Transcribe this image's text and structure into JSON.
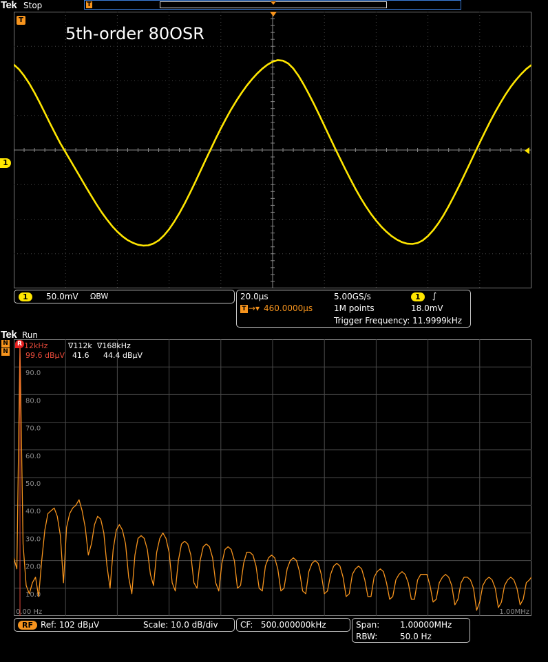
{
  "header": {
    "brand": "Tek",
    "status": "Stop",
    "trigger_marker": "T"
  },
  "scope": {
    "annotation": "5th-order 80OSR",
    "channel_marker": "1",
    "trigger_marker": "T",
    "trace_color": "#ffe600",
    "waveform": {
      "type": "line",
      "series": [
        {
          "x": [
            0.0,
            2.0,
            4.0,
            6.0,
            8.0,
            10.0,
            12.0,
            14.0,
            16.0,
            18.0,
            20.0,
            22.0,
            24.0,
            26.0,
            28.0,
            30.0,
            32.0,
            34.0,
            36.0,
            38.0,
            40.0,
            42.0,
            44.0,
            46.0,
            48.0,
            50.0,
            52.0,
            54.0,
            56.0,
            58.0,
            60.0,
            62.0,
            64.0,
            66.0,
            68.0,
            70.0,
            72.0,
            74.0,
            76.0,
            78.0,
            80.0,
            82.0,
            84.0,
            86.0,
            88.0,
            90.0,
            92.0,
            94.0,
            96.0,
            98.0,
            100.0,
            102.0,
            104.0,
            106.0,
            108.0,
            110.0,
            112.0,
            114.0,
            116.0,
            118.0,
            120.0,
            122.0,
            124.0,
            126.0,
            128.0,
            130.0,
            132.0,
            134.0,
            136.0,
            138.0,
            140.0,
            142.0,
            144.0,
            146.0,
            148.0,
            150.0,
            152.0,
            154.0,
            156.0,
            158.0,
            160.0,
            162.0,
            164.0,
            166.0,
            168.0,
            170.0,
            172.0,
            174.0,
            176.0,
            178.0,
            180.0,
            182.0,
            184.0,
            186.0,
            188.0,
            190.0,
            192.0,
            194.0,
            196.0,
            198.0,
            200.0
          ],
          "y": [
            61.8,
            58.4,
            53.7,
            48.0,
            41.5,
            34.4,
            26.9,
            19.3,
            11.9,
            4.8,
            -1.6,
            -7.9,
            -14.3,
            -20.7,
            -27.1,
            -33.3,
            -39.4,
            -45.1,
            -50.3,
            -55.0,
            -59.0,
            -62.4,
            -65.1,
            -67.1,
            -68.5,
            -69.1,
            -68.9,
            -67.6,
            -65.3,
            -61.8,
            -57.3,
            -51.8,
            -45.6,
            -38.7,
            -31.3,
            -23.6,
            -15.6,
            -7.6,
            0.3,
            8.1,
            15.6,
            22.7,
            29.4,
            35.6,
            41.3,
            46.5,
            51.1,
            55.2,
            58.8,
            61.7,
            63.9,
            65.0,
            64.6,
            62.6,
            58.9,
            53.7,
            47.4,
            40.5,
            33.1,
            25.4,
            17.5,
            9.6,
            1.8,
            -6.0,
            -13.6,
            -20.9,
            -28.0,
            -34.6,
            -40.7,
            -46.2,
            -51.1,
            -55.4,
            -59.1,
            -62.3,
            -64.8,
            -66.6,
            -67.7,
            -67.9,
            -67.2,
            -65.3,
            -62.2,
            -58.1,
            -53.1,
            -47.2,
            -40.6,
            -33.5,
            -26.1,
            -18.3,
            -10.4,
            -2.5,
            5.3,
            13.0,
            20.4,
            27.5,
            34.1,
            40.2,
            45.7,
            50.6,
            54.9,
            58.6,
            61.5
          ]
        }
      ],
      "xlim": [
        0,
        200
      ],
      "ylim": [
        -100,
        100
      ],
      "grid": true
    }
  },
  "scope_readout": {
    "channel": "1",
    "scale": "50.0mV",
    "bw_icon": "ΩBW",
    "timebase": "20.0µs",
    "sample_rate": "5.00GS/s",
    "trig_channel": "1",
    "trig_slope": "∫",
    "trig_label": "T",
    "delay": "460.0000µs",
    "record_length": "1M points",
    "trig_level": "18.0mV",
    "trig_freq": "Trigger Frequency: 11.9999kHz"
  },
  "spec_header": {
    "brand": "Tek",
    "status": "Run"
  },
  "spectrum": {
    "left_badges": [
      "N",
      "N"
    ],
    "ref_marker": "R",
    "cursors": [
      {
        "freq": "12kHz",
        "level": "99.6 dBµV",
        "color": "#f7941d"
      },
      {
        "freq": "∇112k",
        "level": "41.6",
        "color": "#ffffff"
      },
      {
        "freq": "∇168kHz",
        "level": "44.4 dBµV",
        "color": "#ffffff"
      }
    ],
    "trace_color": "#f7941d",
    "y_labels": [
      "90.0",
      "80.0",
      "70.0",
      "60.0",
      "50.0",
      "40.0",
      "30.0",
      "20.0",
      "10.0"
    ],
    "x_start_label": "0.00 Hz",
    "x_end_label": "1.00MHz",
    "chart_data": {
      "type": "line",
      "xlabel": "",
      "ylabel": "",
      "xlim": [
        0,
        1000
      ],
      "ylim": [
        2,
        102
      ],
      "grid": true,
      "series": [
        {
          "x": [
            0,
            6,
            12,
            18,
            24,
            30,
            36,
            42,
            48,
            54,
            60,
            66,
            72,
            78,
            84,
            90,
            96,
            102,
            108,
            114,
            120,
            126,
            132,
            138,
            144,
            150,
            156,
            162,
            168,
            174,
            180,
            186,
            192,
            198,
            204,
            210,
            216,
            222,
            228,
            234,
            240,
            246,
            252,
            258,
            264,
            270,
            276,
            282,
            288,
            294,
            300,
            306,
            312,
            318,
            324,
            330,
            336,
            342,
            348,
            354,
            360,
            366,
            372,
            378,
            384,
            390,
            396,
            402,
            408,
            414,
            420,
            426,
            432,
            438,
            444,
            450,
            456,
            462,
            468,
            474,
            480,
            486,
            492,
            498,
            504,
            510,
            516,
            522,
            528,
            534,
            540,
            546,
            552,
            558,
            564,
            570,
            576,
            582,
            588,
            594,
            600,
            606,
            612,
            618,
            624,
            630,
            636,
            642,
            648,
            654,
            660,
            666,
            672,
            678,
            684,
            690,
            696,
            702,
            708,
            714,
            720,
            726,
            732,
            738,
            744,
            750,
            756,
            762,
            768,
            774,
            780,
            786,
            792,
            798,
            804,
            810,
            816,
            822,
            828,
            834,
            840,
            846,
            852,
            858,
            864,
            870,
            876,
            882,
            888,
            894,
            900,
            906,
            912,
            918,
            924,
            930,
            936,
            942,
            948,
            954,
            960,
            966,
            972,
            978,
            984,
            990,
            996,
            1000
          ],
          "y": [
            23,
            19,
            99.6,
            28,
            13,
            10,
            14,
            16,
            9,
            22,
            33,
            39,
            40,
            41,
            38,
            31,
            14,
            34,
            39,
            41,
            42,
            44,
            40,
            34,
            24,
            28,
            35,
            38,
            37,
            32,
            20,
            12,
            26,
            33,
            35,
            33,
            28,
            16,
            10,
            24,
            30,
            31,
            30,
            26,
            17,
            13,
            25,
            30,
            32,
            30,
            25,
            14,
            11,
            22,
            28,
            29,
            28,
            24,
            14,
            12,
            22,
            27,
            28,
            27,
            23,
            14,
            11,
            21,
            26,
            27,
            26,
            22,
            12,
            13,
            21,
            25,
            25,
            24,
            20,
            12,
            11,
            20,
            23,
            24,
            23,
            19,
            11,
            12,
            19,
            22,
            23,
            22,
            18,
            11,
            10,
            18,
            21,
            22,
            21,
            17,
            10,
            11,
            17,
            20,
            21,
            20,
            16,
            9,
            10,
            17,
            19,
            20,
            19,
            15,
            9,
            9,
            16,
            18,
            19,
            18,
            14,
            8,
            9,
            15,
            17,
            18,
            17,
            14,
            8,
            8,
            15,
            17,
            17,
            17,
            13,
            7,
            8,
            14,
            16,
            17,
            16,
            13,
            6,
            8,
            14,
            16,
            16,
            15,
            12,
            4,
            7,
            13,
            15,
            16,
            15,
            12,
            5,
            7,
            13,
            15,
            16,
            15,
            12,
            6,
            8,
            14,
            15,
            16
          ]
        }
      ]
    }
  },
  "spec_readout": {
    "rf_badge": "RF",
    "ref": "Ref: 102 dBµV",
    "scale": "Scale: 10.0 dB/div",
    "cf": "CF:   500.000000kHz",
    "span_label": "Span:",
    "span_value": "1.00000MHz",
    "rbw_label": "RBW:",
    "rbw_value": "50.0 Hz"
  }
}
